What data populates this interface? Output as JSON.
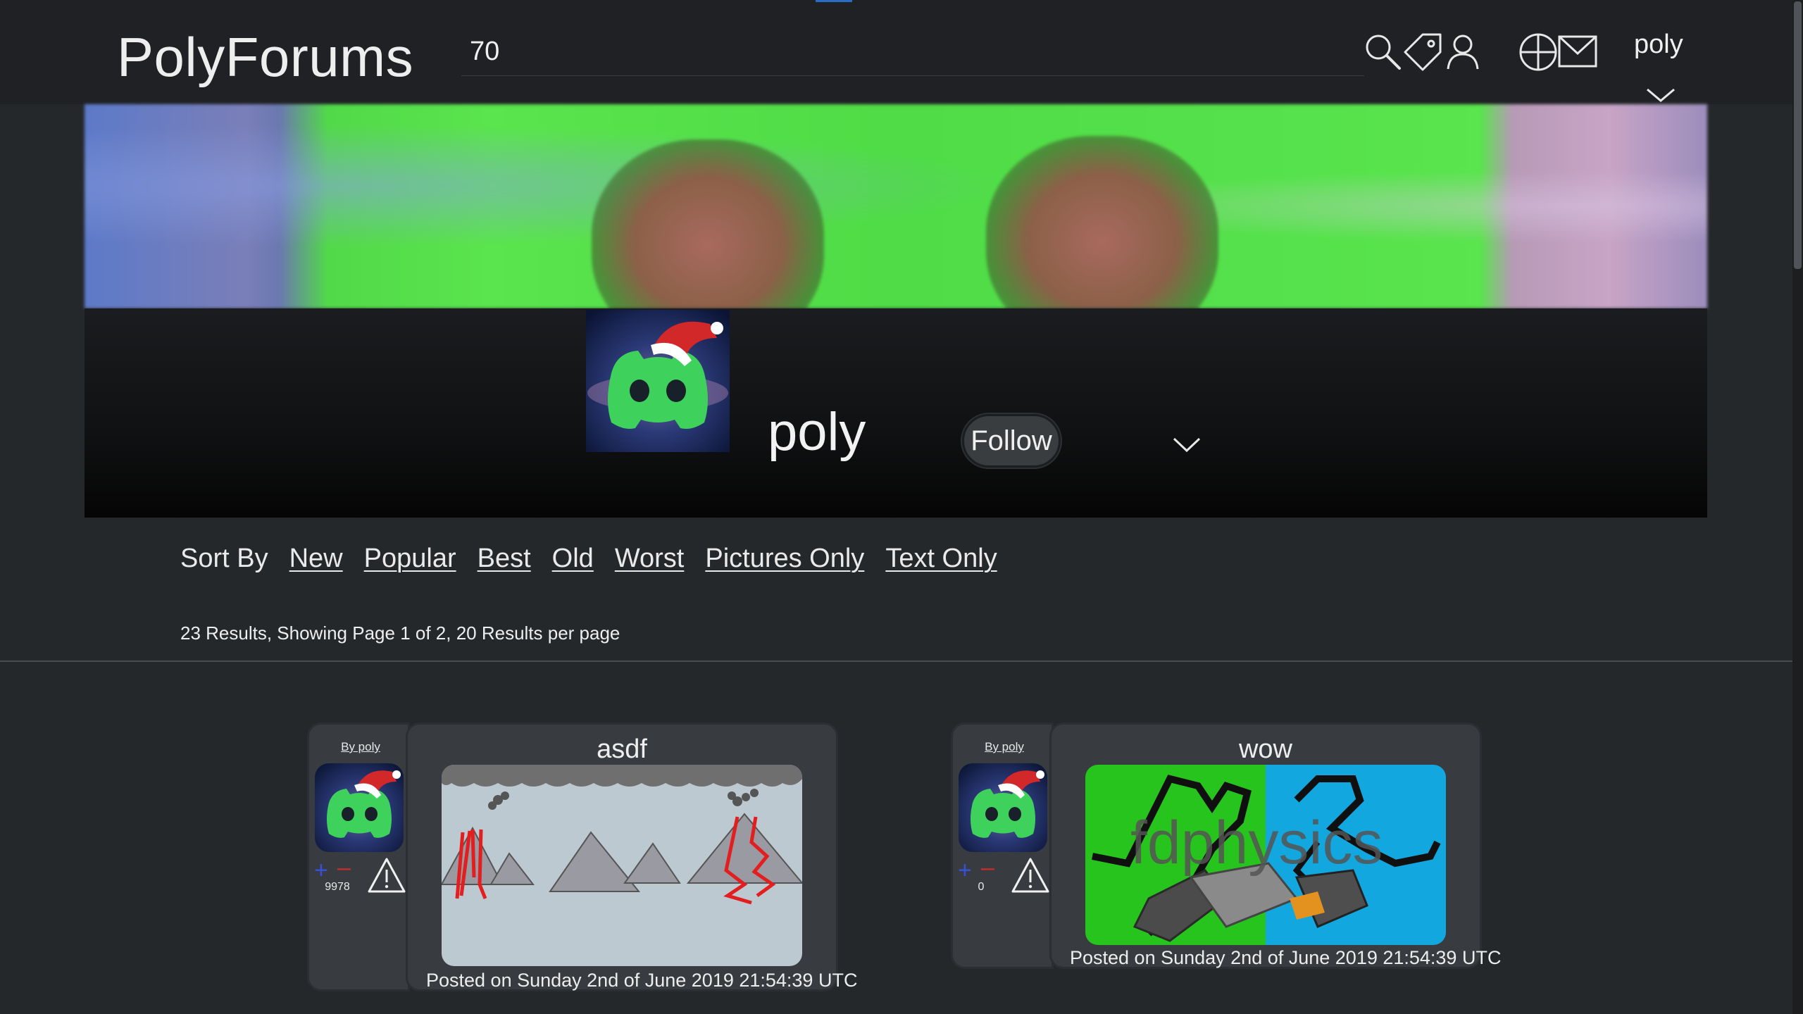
{
  "header": {
    "brand": "PolyForums",
    "search_value": "70",
    "username": "poly",
    "icons": [
      "search-icon",
      "tag-icon",
      "user-icon",
      "add-post-icon",
      "mail-icon",
      "chevron-down-icon"
    ]
  },
  "profile": {
    "name": "poly",
    "follow_label": "Follow"
  },
  "sort": {
    "label": "Sort By",
    "options": [
      "New",
      "Popular",
      "Best",
      "Old",
      "Worst",
      "Pictures Only",
      "Text Only"
    ]
  },
  "results": {
    "summary": "23 Results, Showing Page 1 of 2, 20 Results per page"
  },
  "posts": [
    {
      "by": "By poly",
      "score": "9978",
      "title": "asdf",
      "date": "Posted on Sunday 2nd of June 2019 21:54:39 UTC"
    },
    {
      "by": "By poly",
      "score": "0",
      "title": "wow",
      "date": "Posted on Sunday 2nd of June 2019 21:54:39 UTC",
      "image_text": "fdphysics"
    }
  ],
  "colors": {
    "background": "#25282b",
    "topbar": "#1f2124",
    "card": "#383c41",
    "upvote": "#3850d8",
    "downvote": "#d02b2b",
    "avatar_green": "#3ed15c"
  }
}
